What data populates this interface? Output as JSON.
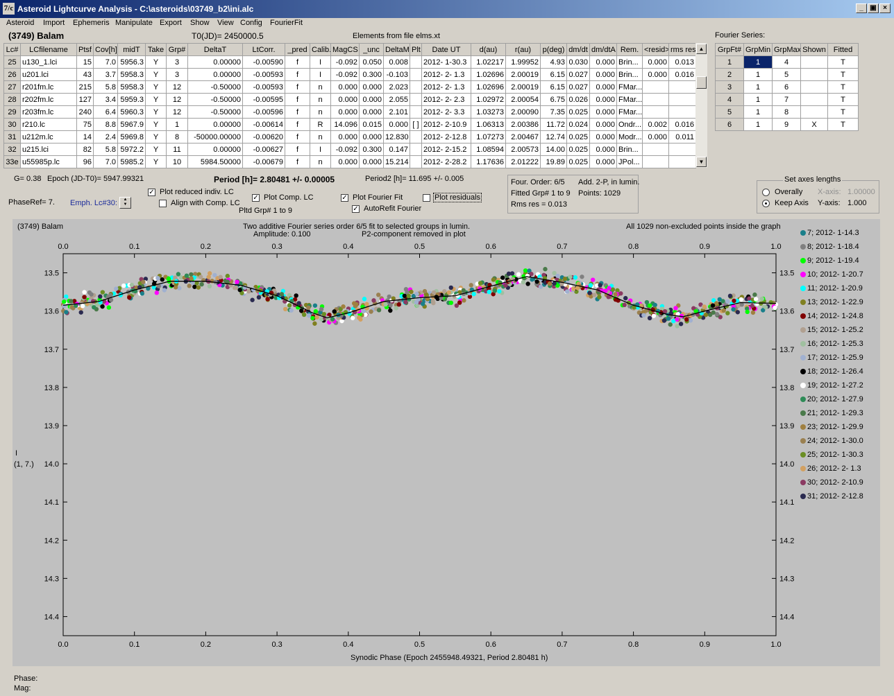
{
  "window": {
    "title": "Asteroid Lightcurve Analysis - C:\\asteroids\\03749_b2\\ini.alc",
    "app_icon": "7/c",
    "min": "_",
    "restore": "▣",
    "close": "×"
  },
  "menu": [
    "Asteroid",
    "Import",
    "Ephemeris",
    "Manipulate",
    "Export",
    "Show",
    "View",
    "Config",
    "FourierFit"
  ],
  "header": {
    "asteroid": "(3749) Balam",
    "t0": "T0(JD)= 2450000.5",
    "elements": "Elements from file elms.xt"
  },
  "lc_table": {
    "columns": [
      "Lc#",
      "LCfilename",
      "Ptsf",
      "Cov[h]",
      "midT",
      "Take",
      "Grp#",
      "DeltaT",
      "LtCorr.",
      "_pred",
      "Calib.",
      "MagCS",
      "_unc",
      "DeltaM",
      "Plt",
      "Date UT",
      "d(au)",
      "r(au)",
      "p(deg)",
      "dm/dt",
      "dm/dtA",
      "Rem.",
      "<resid>",
      "rms res"
    ],
    "rows": [
      [
        "25",
        "u130_1.lci",
        "15",
        "7.0",
        "5956.3",
        "Y",
        "3",
        "0.00000",
        "-0.00590",
        "f",
        "I",
        "-0.092",
        "0.050",
        "0.008",
        "",
        "2012- 1-30.3",
        "1.02217",
        "1.99952",
        "4.93",
        "0.030",
        "0.000",
        "Brin...",
        "0.000",
        "0.013"
      ],
      [
        "26",
        "u201.lci",
        "43",
        "3.7",
        "5958.3",
        "Y",
        "3",
        "0.00000",
        "-0.00593",
        "f",
        "I",
        "-0.092",
        "0.300",
        "-0.103",
        "",
        "2012- 2- 1.3",
        "1.02696",
        "2.00019",
        "6.15",
        "0.027",
        "0.000",
        "Brin...",
        "0.000",
        "0.016"
      ],
      [
        "27",
        "r201fm.lc",
        "215",
        "5.8",
        "5958.3",
        "Y",
        "12",
        "-0.50000",
        "-0.00593",
        "f",
        "n",
        "0.000",
        "0.000",
        "2.023",
        "",
        "2012- 2- 1.3",
        "1.02696",
        "2.00019",
        "6.15",
        "0.027",
        "0.000",
        "FMar...",
        "",
        ""
      ],
      [
        "28",
        "r202fm.lc",
        "127",
        "3.4",
        "5959.3",
        "Y",
        "12",
        "-0.50000",
        "-0.00595",
        "f",
        "n",
        "0.000",
        "0.000",
        "2.055",
        "",
        "2012- 2- 2.3",
        "1.02972",
        "2.00054",
        "6.75",
        "0.026",
        "0.000",
        "FMar...",
        "",
        ""
      ],
      [
        "29",
        "r203fm.lc",
        "240",
        "6.4",
        "5960.3",
        "Y",
        "12",
        "-0.50000",
        "-0.00596",
        "f",
        "n",
        "0.000",
        "0.000",
        "2.101",
        "",
        "2012- 2- 3.3",
        "1.03273",
        "2.00090",
        "7.35",
        "0.025",
        "0.000",
        "FMar...",
        "",
        ""
      ],
      [
        "30",
        "r210.lc",
        "75",
        "8.8",
        "5967.9",
        "Y",
        "1",
        "0.00000",
        "-0.00614",
        "f",
        "R",
        "14.096",
        "0.015",
        "0.000",
        "[ ]",
        "2012- 2-10.9",
        "1.06313",
        "2.00386",
        "11.72",
        "0.024",
        "0.000",
        "Ondr...",
        "0.002",
        "0.016"
      ],
      [
        "31",
        "u212m.lc",
        "14",
        "2.4",
        "5969.8",
        "Y",
        "8",
        "-50000.00000",
        "-0.00620",
        "f",
        "n",
        "0.000",
        "0.000",
        "12.830",
        "",
        "2012- 2-12.8",
        "1.07273",
        "2.00467",
        "12.74",
        "0.025",
        "0.000",
        "Modr...",
        "0.000",
        "0.011"
      ],
      [
        "32",
        "u215.lci",
        "82",
        "5.8",
        "5972.2",
        "Y",
        "11",
        "0.00000",
        "-0.00627",
        "f",
        "I",
        "-0.092",
        "0.300",
        "0.147",
        "",
        "2012- 2-15.2",
        "1.08594",
        "2.00573",
        "14.00",
        "0.025",
        "0.000",
        "Brin...",
        "",
        ""
      ],
      [
        "33e",
        "u55985p.lc",
        "96",
        "7.0",
        "5985.2",
        "Y",
        "10",
        "5984.50000",
        "-0.00679",
        "f",
        "n",
        "0.000",
        "0.000",
        "15.214",
        "",
        "2012- 2-28.2",
        "1.17636",
        "2.01222",
        "19.89",
        "0.025",
        "0.000",
        "JPol...",
        "",
        ""
      ]
    ]
  },
  "fourier_series": {
    "label": "Fourier Series:",
    "columns": [
      "GrpFt#",
      "GrpMin",
      "GrpMax",
      "Shown",
      "Fitted"
    ],
    "rows": [
      [
        "1",
        "1",
        "4",
        "",
        "T"
      ],
      [
        "2",
        "1",
        "5",
        "",
        "T"
      ],
      [
        "3",
        "1",
        "6",
        "",
        "T"
      ],
      [
        "4",
        "1",
        "7",
        "",
        "T"
      ],
      [
        "5",
        "1",
        "8",
        "",
        "T"
      ],
      [
        "6",
        "1",
        "9",
        "X",
        "T"
      ]
    ]
  },
  "info": {
    "g": "G= 0.38",
    "epoch": "Epoch (JD-T0)= 5947.99321",
    "period": "Period [h]= 2.80481 +/- 0.00005",
    "period2": "Period2 [h]= 11.695 +/- 0.005",
    "phaseref": "PhaseRef= 7.",
    "emph": "Emph. Lc#30:"
  },
  "options": {
    "plot_reduced": "Plot reduced indiv. LC",
    "align": "Align with Comp. LC",
    "plot_comp": "Plot Comp. LC",
    "pltd_grp": "Pltd Grp#  1   to    9",
    "plot_fourier": "Plot Fourier Fit",
    "autorefit": "AutoRefit Fourier",
    "plot_residuals": "Plot residuals"
  },
  "fit_box": {
    "order": "Four. Order:  6/5",
    "add": "Add. 2-P, in lumin.",
    "fitted": "Fitted Grp# 1 to 9",
    "points": "Points: 1029",
    "rms": "Rms res     = 0.013"
  },
  "axes_box": {
    "title": "Set axes lengths",
    "overally": "Overally",
    "keep": "Keep Axis",
    "xaxis": "X-axis:",
    "xval": "1.00000",
    "yaxis": "Y-axis:",
    "yval": "1.000"
  },
  "plot": {
    "name": "(3749) Balam",
    "subtitle1": "Two additive Fourier series order 6/5 fit to selected groups in lumin.",
    "subtitle2a": "Amplitude: 0.100",
    "subtitle2b": "P2-component removed in plot",
    "right_note": "All 1029 non-excluded points inside the graph",
    "ylabel1": "I",
    "ylabel2": "(1, 7.)",
    "xlabel": "Synodic Phase (Epoch 2455948.49321, Period 2.80481 h)"
  },
  "status": {
    "phase": "Phase:",
    "mag": "Mag:"
  },
  "chart_data": {
    "type": "scatter",
    "xlim": [
      0,
      1
    ],
    "ylim": [
      14.45,
      13.45
    ],
    "inverted_y": true,
    "x_ticks": [
      "0.0",
      "0.1",
      "0.2",
      "0.3",
      "0.4",
      "0.5",
      "0.6",
      "0.7",
      "0.8",
      "0.9",
      "1.0"
    ],
    "y_ticks": [
      "13.5",
      "13.6",
      "13.7",
      "13.8",
      "13.9",
      "14.0",
      "14.1",
      "14.2",
      "14.3",
      "14.4"
    ],
    "fourier_fit": {
      "x": [
        0,
        0.05,
        0.1,
        0.15,
        0.2,
        0.25,
        0.3,
        0.35,
        0.37,
        0.4,
        0.45,
        0.5,
        0.55,
        0.6,
        0.65,
        0.7,
        0.75,
        0.8,
        0.85,
        0.87,
        0.9,
        0.95,
        1.0
      ],
      "y": [
        13.585,
        13.575,
        13.545,
        13.522,
        13.522,
        13.533,
        13.56,
        13.605,
        13.618,
        13.605,
        13.575,
        13.565,
        13.56,
        13.535,
        13.51,
        13.525,
        13.545,
        13.585,
        13.61,
        13.615,
        13.6,
        13.578,
        13.58
      ]
    },
    "series": [
      {
        "name": "7; 2012- 1-14.3",
        "color": "#1a7f8a"
      },
      {
        "name": "8; 2012- 1-18.4",
        "color": "#808080"
      },
      {
        "name": "9; 2012- 1-19.4",
        "color": "#00ff00"
      },
      {
        "name": "10; 2012- 1-20.7",
        "color": "#ff00ff"
      },
      {
        "name": "11; 2012- 1-20.9",
        "color": "#00ffff"
      },
      {
        "name": "13; 2012- 1-22.9",
        "color": "#808020"
      },
      {
        "name": "14; 2012- 1-24.8",
        "color": "#800000"
      },
      {
        "name": "15; 2012- 1-25.2",
        "color": "#b0a090"
      },
      {
        "name": "16; 2012- 1-25.3",
        "color": "#a0c0a0"
      },
      {
        "name": "17; 2012- 1-25.9",
        "color": "#a0b0d0"
      },
      {
        "name": "18; 2012- 1-26.4",
        "color": "#000000"
      },
      {
        "name": "19; 2012- 1-27.2",
        "color": "#ffffff"
      },
      {
        "name": "20; 2012- 1-27.9",
        "color": "#2e8b57"
      },
      {
        "name": "21; 2012- 1-29.3",
        "color": "#4a7a4a"
      },
      {
        "name": "23; 2012- 1-29.9",
        "color": "#a08040"
      },
      {
        "name": "24; 2012- 1-30.0",
        "color": "#9a8050"
      },
      {
        "name": "25; 2012- 1-30.3",
        "color": "#6b8e23"
      },
      {
        "name": "26; 2012- 2- 1.3",
        "color": "#d2a060"
      },
      {
        "name": "30; 2012- 2-10.9",
        "color": "#8b3a62"
      },
      {
        "name": "31; 2012- 2-12.8",
        "color": "#2a2a50"
      }
    ]
  }
}
